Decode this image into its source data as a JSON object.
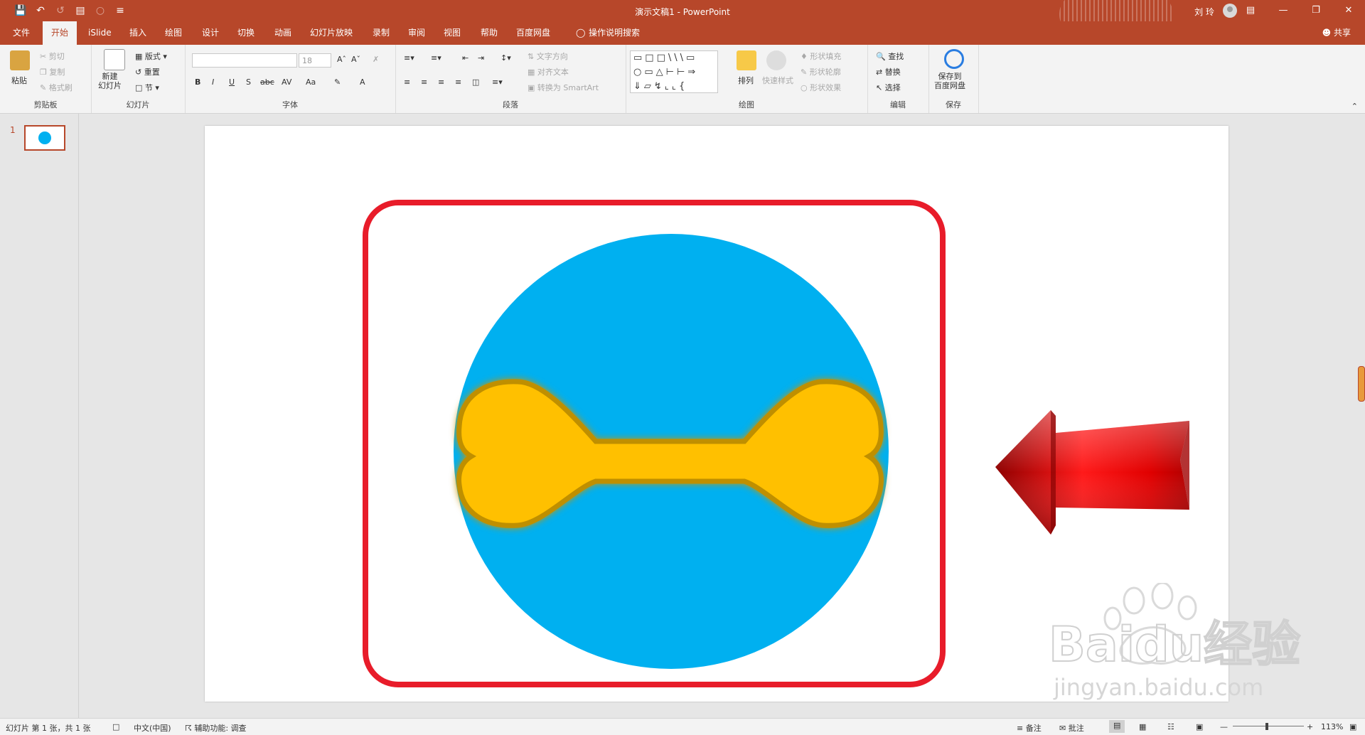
{
  "titlebar": {
    "doc_title": "演示文稿1  -  PowerPoint",
    "user": "刘 玲",
    "qat_icons": [
      "save-icon",
      "undo-icon",
      "redo-icon",
      "present-icon",
      "touch-mode-icon",
      "customize-icon"
    ],
    "window_controls": [
      "ribbon-display-icon",
      "minimize-icon",
      "restore-icon",
      "close-icon"
    ]
  },
  "tabs": [
    "文件",
    "开始",
    "iSlide",
    "插入",
    "绘图",
    "设计",
    "切换",
    "动画",
    "幻灯片放映",
    "录制",
    "审阅",
    "视图",
    "帮助",
    "百度网盘",
    "操作说明搜索"
  ],
  "share_label": "共享",
  "ribbon": {
    "clipboard": {
      "paste": "粘贴",
      "cut": "剪切",
      "copy": "复制",
      "format_painter": "格式刷",
      "label": "剪贴板"
    },
    "slides": {
      "new_slide": "新建\n幻灯片",
      "layout": "版式",
      "reset": "重置",
      "section": "节",
      "label": "幻灯片"
    },
    "font": {
      "size": "18",
      "bold": "B",
      "italic": "I",
      "underline": "U",
      "shadow": "S",
      "strike": "abc",
      "spacing": "AV",
      "case": "Aa",
      "color": "A",
      "label": "字体"
    },
    "paragraph": {
      "text_direction": "文字方向",
      "align_text": "对齐文本",
      "smartart": "转换为 SmartArt",
      "label": "段落"
    },
    "drawing": {
      "arrange": "排列",
      "quick_styles": "快速样式",
      "fill": "形状填充",
      "outline": "形状轮廓",
      "effects": "形状效果",
      "label": "绘图"
    },
    "editing": {
      "find": "查找",
      "replace": "替换",
      "select": "选择",
      "label": "编辑"
    },
    "save": {
      "save_to": "保存到\n百度网盘",
      "label": "保存"
    }
  },
  "thumb": {
    "number": "1"
  },
  "statusbar": {
    "slide_info": "幻灯片 第 1 张，共 1 张",
    "language": "中文(中国)",
    "accessibility": "辅助功能: 调查",
    "notes": "备注",
    "comments": "批注",
    "zoom": "113%"
  },
  "watermark": {
    "brand": "Baidu经验",
    "url": "jingyan.baidu.com"
  },
  "colors": {
    "accent": "#b7472a",
    "circle": "#00b0f0",
    "bone_fill": "#ffc000",
    "bone_outline": "#bf8f00",
    "frame": "#e81c2a",
    "arrow": "#e00000"
  }
}
